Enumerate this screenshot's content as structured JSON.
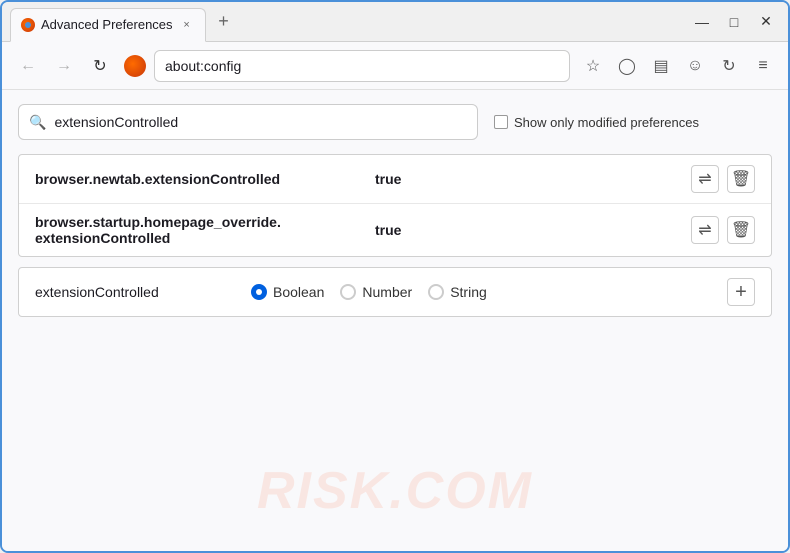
{
  "window": {
    "title": "Advanced Preferences",
    "tab_close": "×",
    "new_tab": "+",
    "minimize": "—",
    "maximize": "□",
    "close": "✕"
  },
  "browser": {
    "url": "about:config",
    "browser_name": "Firefox"
  },
  "nav": {
    "back": "←",
    "forward": "→",
    "reload": "↻",
    "bookmark": "☆",
    "shield": "🛡",
    "menu": "≡",
    "star_icon": "☆",
    "pocket_icon": "⬡",
    "screenshot_icon": "⬛",
    "profile_icon": "☺",
    "sync_icon": "↻"
  },
  "search": {
    "placeholder": "extensionControlled",
    "value": "extensionControlled",
    "show_modified_label": "Show only modified preferences"
  },
  "preferences": [
    {
      "name": "browser.newtab.extensionControlled",
      "value": "true"
    },
    {
      "name_line1": "browser.startup.homepage_override.",
      "name_line2": "extensionControlled",
      "value": "true"
    }
  ],
  "new_pref": {
    "name": "extensionControlled",
    "boolean_label": "Boolean",
    "number_label": "Number",
    "string_label": "String",
    "add_icon": "+"
  },
  "watermark": "RISK.COM",
  "icons": {
    "search": "🔍",
    "toggle": "⇌",
    "delete": "🗑",
    "boolean_selected": true
  }
}
